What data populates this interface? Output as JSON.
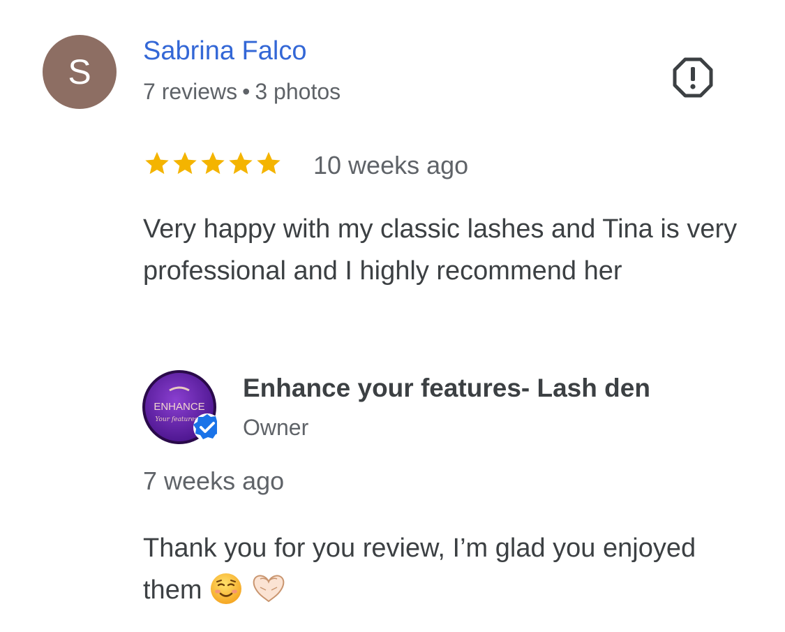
{
  "reviewer": {
    "initial": "S",
    "name": "Sabrina Falco",
    "reviews": "7 reviews",
    "separator": "•",
    "photos": "3 photos",
    "avatar_color": "#8d6e63",
    "name_color": "#3367d6"
  },
  "flag_icon": "report-icon",
  "review": {
    "rating": 5,
    "max_rating": 5,
    "star_color": "#f4b400",
    "time": "10 weeks ago",
    "text": "Very happy with my classic lashes and Tina is very professional and I highly recommend her"
  },
  "owner": {
    "logo_text": "ENHANCE",
    "logo_script": "Your features",
    "logo_color": "#6a1fa6",
    "verified_color": "#1a73e8",
    "name": "Enhance your features- Lash den",
    "role": "Owner",
    "reply_time": "7 weeks ago",
    "reply_text": "Thank you for you review, I’m glad you enjoyed them",
    "reply_emojis": [
      "smiling-face-icon",
      "heart-hands-icon"
    ]
  }
}
